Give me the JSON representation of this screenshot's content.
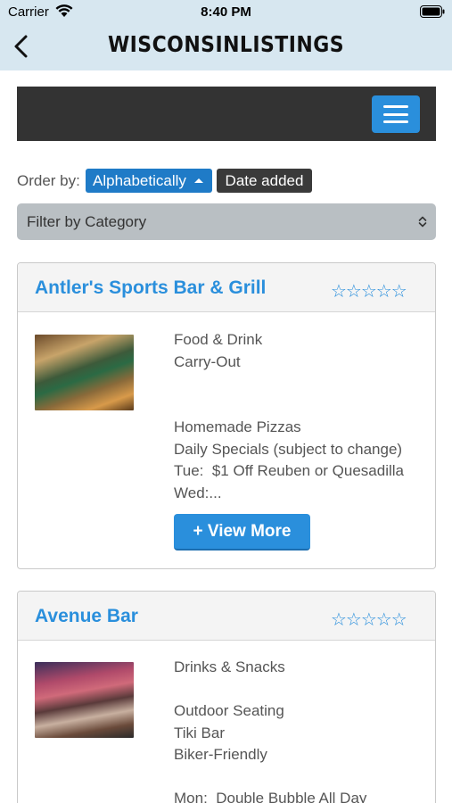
{
  "status_bar": {
    "carrier": "Carrier",
    "time": "8:40 PM"
  },
  "nav": {
    "title": "WISCONSINLISTINGS"
  },
  "sort": {
    "label": "Order by:",
    "alphabetically": "Alphabetically",
    "date_added": "Date added"
  },
  "filter": {
    "label": "Filter by Category"
  },
  "listings": [
    {
      "name": "Antler's Sports Bar & Grill",
      "rating_stars": "☆☆☆☆☆",
      "description": "Food & Drink\nCarry-Out\n\n\nHomemade Pizzas\nDaily Specials (subject to change)\nTue:  $1 Off Reuben or Quesadilla\nWed:...",
      "button": "+ View More"
    },
    {
      "name": "Avenue Bar",
      "rating_stars": "☆☆☆☆☆",
      "description": "Drinks & Snacks\n\nOutdoor Seating\nTiki Bar\nBiker-Friendly\n\nMon:  Double Bubble All Day"
    }
  ],
  "colors": {
    "accent": "#2a8fdc",
    "topbar": "#d7e7f0",
    "sitebar": "#333333"
  }
}
